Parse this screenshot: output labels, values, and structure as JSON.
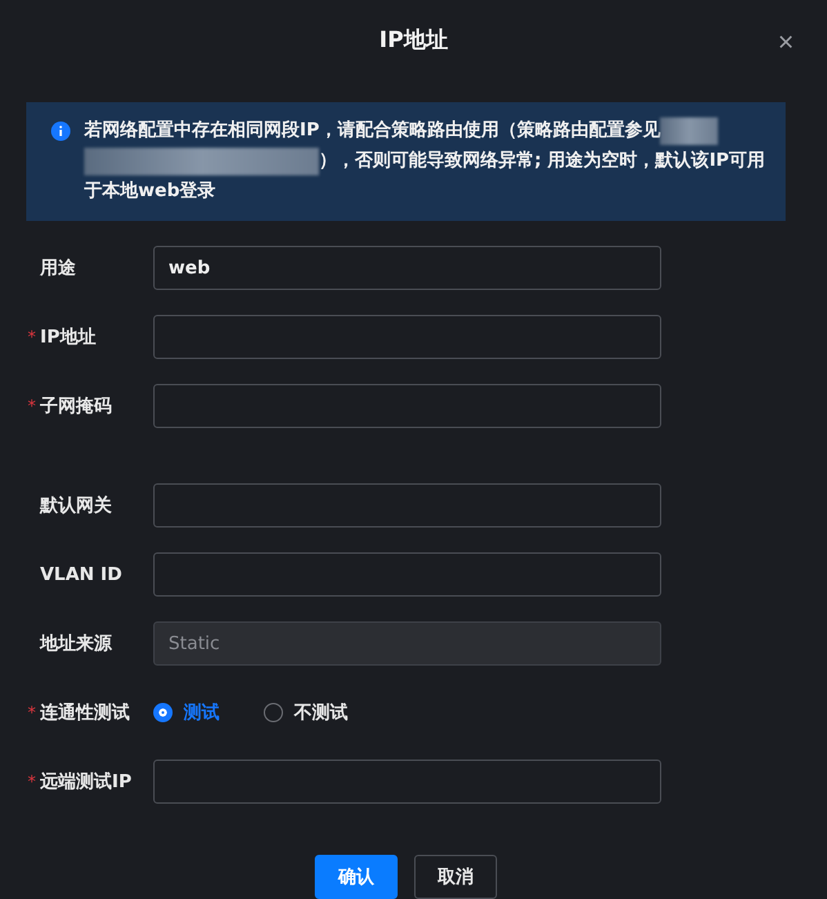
{
  "dialog": {
    "title": "IP地址",
    "close": "×"
  },
  "notice": {
    "line_1": "若网络配置中存在相同网段IP，请配合策略路由使用（策略路由配置参见",
    "line_2": "），否则可能导致网络异常; 用途为空时，默认该IP可用",
    "line_3": "于本地web登录"
  },
  "sections": [
    {
      "fields": [
        {
          "kind": "input",
          "label": "用途",
          "value": "web",
          "disabled": false
        },
        {
          "kind": "input",
          "label": "IP地址",
          "mark": "*",
          "disabled": false
        },
        {
          "kind": "input",
          "label": "子网掩码",
          "mark": "*",
          "disabled": false
        }
      ]
    },
    {
      "fields": [
        {
          "kind": "input",
          "label": "默认网关",
          "disabled": false
        },
        {
          "kind": "input",
          "label": "VLAN ID",
          "disabled": false
        },
        {
          "kind": "input",
          "label": "地址来源",
          "value": "Static",
          "disabled": true
        },
        {
          "kind": "radio",
          "label": "连通性测试",
          "mark": "*",
          "options": [
            {
              "label": "测试",
              "selected": true
            },
            {
              "label": "不测试",
              "selected": false
            }
          ]
        },
        {
          "kind": "input",
          "label": "远端测试IP",
          "mark": "*",
          "disabled": false
        }
      ]
    }
  ],
  "buttons": [
    {
      "label": "确认",
      "kind": "primary"
    },
    {
      "label": "取消",
      "kind": "secondary"
    }
  ]
}
